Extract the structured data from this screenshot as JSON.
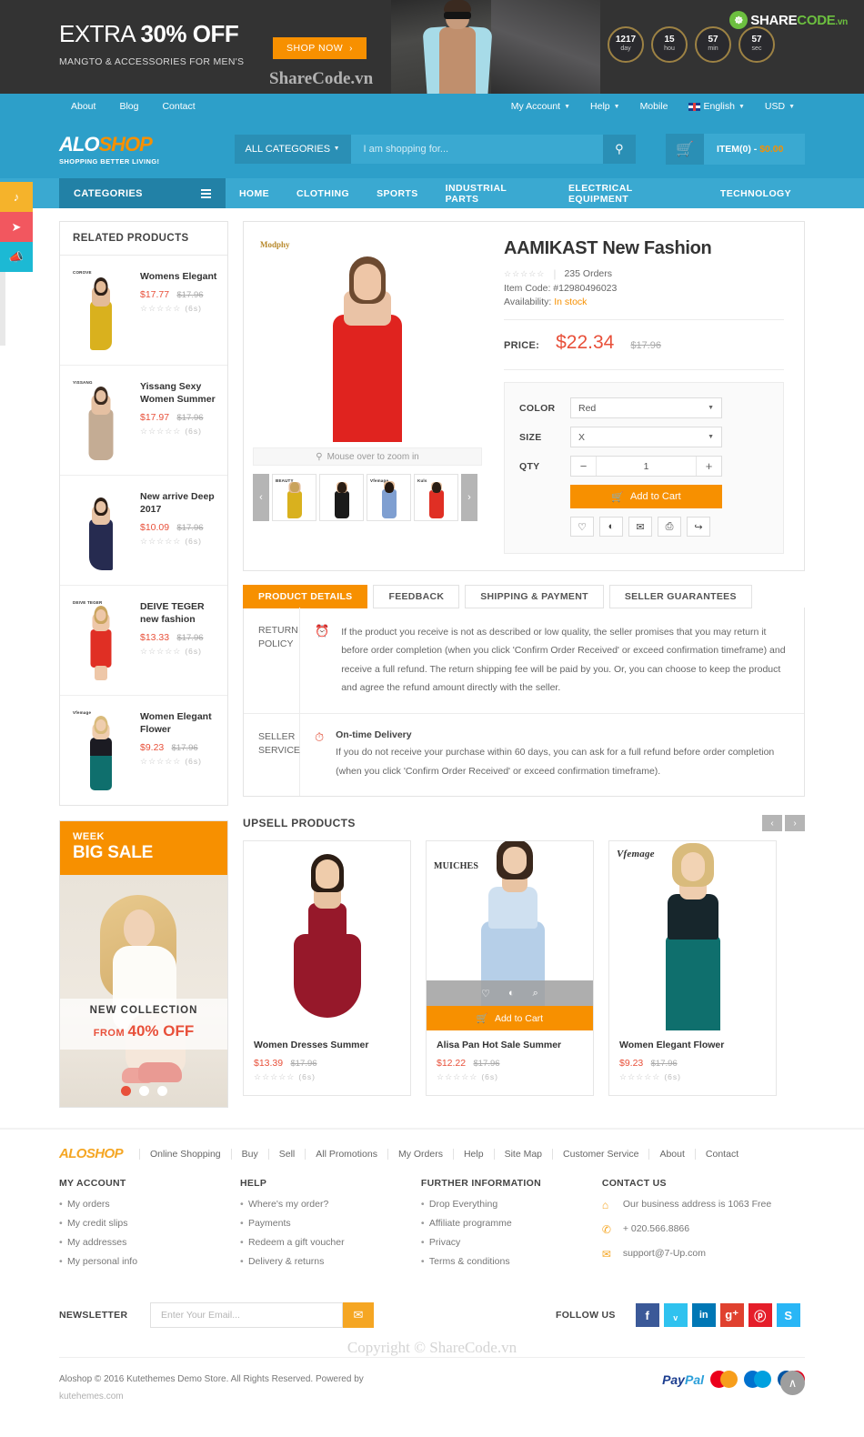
{
  "promo": {
    "headline_pre": "EXTRA ",
    "headline_strong": "30% OFF",
    "subtitle": "MANGTO & ACCESSORIES FOR MEN'S",
    "shop_now": "SHOP NOW",
    "shop_now_arrow": "›",
    "watermark": "ShareCode.vn",
    "countdown": [
      {
        "value": "1217",
        "unit": "day"
      },
      {
        "value": "15",
        "unit": "hou"
      },
      {
        "value": "57",
        "unit": "min"
      },
      {
        "value": "57",
        "unit": "sec"
      }
    ],
    "brand_logo": {
      "mark": "A",
      "text_a": "SHARE",
      "text_b": "CODE",
      "text_c": ".vn"
    }
  },
  "utilbar": {
    "left": [
      "About",
      "Blog",
      "Contact"
    ],
    "right": [
      {
        "label": "My Account",
        "caret": true,
        "flag": false
      },
      {
        "label": "Help",
        "caret": true,
        "flag": false
      },
      {
        "label": "Mobile",
        "caret": false,
        "flag": false
      },
      {
        "label": "English",
        "caret": true,
        "flag": true
      },
      {
        "label": "USD",
        "caret": true,
        "flag": false
      }
    ]
  },
  "header": {
    "logo_alo": "ALO",
    "logo_shop": "SHOP",
    "tagline": "SHOPPING BETTER LIVING!",
    "all_categories": "ALL CATEGORIES",
    "search_placeholder": "I am shopping for...",
    "search_value": "",
    "cart_items": "ITEM(0) - ",
    "cart_amount": "$0.00"
  },
  "mainnav": {
    "categories_label": "CATEGORIES",
    "items": [
      "HOME",
      "CLOTHING",
      "SPORTS",
      "INDUSTRIAL PARTS",
      "ELECTRICAL EQUIPMENT",
      "TECHNOLOGY"
    ]
  },
  "side_buttons": [
    {
      "name": "music-icon",
      "glyph": "♪",
      "color": "#f5b32b"
    },
    {
      "name": "send-icon",
      "glyph": "➤",
      "color": "#f2575f"
    },
    {
      "name": "megaphone-icon",
      "glyph": "📣",
      "color": "#1cb9d4"
    }
  ],
  "related": {
    "title": "RELATED PRODUCTS",
    "items": [
      {
        "name": "Womens Elegant",
        "price": "$17.77",
        "old_price": "$17.96",
        "stars": "☆☆☆☆☆",
        "count": "(6s)",
        "brand": "COROVE",
        "dress_color": "#d9b11e",
        "hair": "#2e2018",
        "skin": "#e3bb98"
      },
      {
        "name": "Yissang Sexy Women Summer",
        "price": "$17.97",
        "old_price": "$17.96",
        "stars": "☆☆☆☆☆",
        "count": "(6s)",
        "brand": "YISSANG",
        "dress_color": "#c4ac94",
        "hair": "#3b2a1f",
        "skin": "#e5c0a2"
      },
      {
        "name": "New arrive Deep 2017",
        "price": "$10.09",
        "old_price": "$17.96",
        "stars": "☆☆☆☆☆",
        "count": "(6s)",
        "brand": "",
        "dress_color": "#262b50",
        "hair": "#2b1d14",
        "skin": "#e7c3a5"
      },
      {
        "name": "DEIVE TEGER new fashion",
        "price": "$13.33",
        "old_price": "$17.96",
        "stars": "☆☆☆☆☆",
        "count": "(6s)",
        "brand": "DEIVE TEGER",
        "dress_color": "#e02f24",
        "hair": "#caa55f",
        "skin": "#eec7a8"
      },
      {
        "name": "Women Elegant Flower",
        "price": "$9.23",
        "old_price": "$17.96",
        "stars": "☆☆☆☆☆",
        "count": "(6s)",
        "brand": "Vfemage",
        "dress_color": "#0f6f6d",
        "hair": "#d9bb7c",
        "skin": "#efcdae"
      }
    ]
  },
  "product": {
    "brand_watermark": "Modphy",
    "zoom_hint": "Mouse over to zoom in",
    "title": "AAMIKAST New Fashion",
    "stars": "☆☆☆☆☆",
    "orders": "235 Orders",
    "item_code_label": "Item Code: ",
    "item_code": "#12980496023",
    "availability_label": "Availability: ",
    "availability": "In stock",
    "price_label": "PRICE:",
    "price": "$22.34",
    "old_price": "$17.96",
    "options": {
      "color_label": "COLOR",
      "color_value": "Red",
      "size_label": "SIZE",
      "size_value": "X",
      "qty_label": "QTY",
      "qty_value": "1",
      "minus": "−",
      "plus": "+",
      "add_to_cart": "Add to Cart"
    },
    "action_icons": [
      {
        "name": "wishlist-icon",
        "glyph": "♡"
      },
      {
        "name": "compare-icon",
        "glyph": "◐"
      },
      {
        "name": "email-icon",
        "glyph": "✉"
      },
      {
        "name": "print-icon",
        "glyph": "⎙"
      },
      {
        "name": "share-icon",
        "glyph": "↪"
      }
    ],
    "thumbnails": [
      {
        "brand": "BEAUTY",
        "dress_color": "#d9b11e"
      },
      {
        "brand": "",
        "dress_color": "#1a1a1a"
      },
      {
        "brand": "Vfemage",
        "dress_color": "#7f9fd1"
      },
      {
        "brand": "Kuls",
        "dress_color": "#e02f24"
      }
    ],
    "thumb_prev": "‹",
    "thumb_next": "›"
  },
  "tabs": [
    {
      "label": "PRODUCT DETAILS",
      "active": true
    },
    {
      "label": "FEEDBACK",
      "active": false
    },
    {
      "label": "SHIPPING & PAYMENT",
      "active": false
    },
    {
      "label": "SELLER GUARANTEES",
      "active": false
    }
  ],
  "policies": [
    {
      "label": "RETURN POLICY",
      "icon": "clock-icon",
      "heading": "",
      "text": "If the product you receive is not as described or low quality, the seller promises that you may return it before order completion (when you click 'Confirm Order Received' or exceed confirmation timeframe) and receive a full refund. The return shipping fee will be paid by you. Or, you can choose to keep the product and agree the refund amount directly with the seller."
    },
    {
      "label": "SELLER SERVICE",
      "icon": "stopwatch-icon",
      "heading": "On-time Delivery",
      "text": "If you do not receive your purchase within 60 days, you can ask for a full refund before order completion (when you click 'Confirm Order Received' or exceed confirmation timeframe)."
    }
  ],
  "upsell": {
    "title": "UPSELL PRODUCTS",
    "prev": "‹",
    "next": "›",
    "items": [
      {
        "name": "Women Dresses Summer",
        "price": "$13.39",
        "old_price": "$17.96",
        "stars": "☆☆☆☆☆",
        "count": "(6s)",
        "brand": "",
        "dress_color": "#96182a",
        "hair": "#2b1d14",
        "skin": "#e8c3a2",
        "hovered": false
      },
      {
        "name": "Alisa Pan Hot Sale Summer",
        "price": "$12.22",
        "old_price": "$17.96",
        "stars": "☆☆☆☆☆",
        "count": "(6s)",
        "brand": "MUICHES",
        "dress_color": "#b6cfe8",
        "hair": "#3a281c",
        "skin": "#e8c3a2",
        "hovered": true,
        "add_to_cart": "Add to Cart"
      },
      {
        "name": "Women Elegant Flower",
        "price": "$9.23",
        "old_price": "$17.96",
        "stars": "☆☆☆☆☆",
        "count": "(6s)",
        "brand": "Vfemage",
        "dress_color": "#0f6f6d",
        "hair": "#d9bb7c",
        "skin": "#efcdae",
        "hovered": false
      }
    ],
    "hover_icons": [
      {
        "name": "wishlist-icon",
        "glyph": "♡"
      },
      {
        "name": "compare-icon",
        "glyph": "◐"
      },
      {
        "name": "quickview-icon",
        "glyph": "⌕"
      }
    ]
  },
  "sale_banner": {
    "week": "WEEK",
    "big_sale": "BIG SALE",
    "new_collection": "NEW COLLECTION",
    "from": "FROM",
    "percent": "40% OFF",
    "dots": [
      true,
      false,
      false
    ]
  },
  "footer": {
    "logo": "ALOSHOP",
    "links": [
      "Online Shopping",
      "Buy",
      "Sell",
      "All Promotions",
      "My Orders",
      "Help",
      "Site Map",
      "Customer Service",
      "About",
      "Contact"
    ],
    "columns": [
      {
        "title": "MY ACCOUNT",
        "items": [
          "My orders",
          "My credit slips",
          "My addresses",
          "My personal info"
        ]
      },
      {
        "title": "HELP",
        "items": [
          "Where's my order?",
          "Payments",
          "Redeem a gift voucher",
          "Delivery & returns"
        ]
      },
      {
        "title": "FURTHER INFORMATION",
        "items": [
          "Drop Everything",
          "Affiliate programme",
          "Privacy",
          "Terms & conditions"
        ]
      }
    ],
    "contact": {
      "title": "CONTACT US",
      "items": [
        {
          "icon": "home-icon",
          "glyph": "⌂",
          "text": "Our business address is 1063 Free"
        },
        {
          "icon": "phone-icon",
          "glyph": "✆",
          "text": "+ 020.566.8866"
        },
        {
          "icon": "mail-icon",
          "glyph": "✉",
          "text": "support@7-Up.com"
        }
      ]
    },
    "newsletter_label": "NEWSLETTER",
    "newsletter_placeholder": "Enter Your Email...",
    "newsletter_value": "",
    "newsletter_button": "✉",
    "follow_label": "FOLLOW US",
    "social": [
      {
        "name": "facebook-icon",
        "glyph": "f",
        "color": "#3b5998"
      },
      {
        "name": "twitter-icon",
        "glyph": "ᵥ",
        "color": "#2fc2ef"
      },
      {
        "name": "linkedin-icon",
        "glyph": "in",
        "color": "#0077b5"
      },
      {
        "name": "google-plus-icon",
        "glyph": "g⁺",
        "color": "#e0412f"
      },
      {
        "name": "pinterest-icon",
        "glyph": "ⓟ",
        "color": "#e51e2a"
      },
      {
        "name": "skype-icon",
        "glyph": "S",
        "color": "#29b6f6"
      }
    ],
    "copyright_watermark": "Copyright © ShareCode.vn",
    "copyright": "Aloshop © 2016 Kutethemes Demo Store. All Rights Reserved. Powered by",
    "copyright_sub": "kutehemes.com",
    "payments": [
      {
        "name": "paypal-logo",
        "label_a": "Pay",
        "label_b": "Pal"
      },
      {
        "name": "mastercard-logo",
        "left": "#eb001b",
        "right": "#f79e1b",
        "label": "MasterCard"
      },
      {
        "name": "cirrus-logo",
        "left": "#0071ce",
        "right": "#00a0df",
        "label": "Cirrus"
      },
      {
        "name": "maestro-logo",
        "left": "#0055a4",
        "right": "#e2001a",
        "label": "Maestro"
      }
    ],
    "back_to_top": "∧"
  }
}
